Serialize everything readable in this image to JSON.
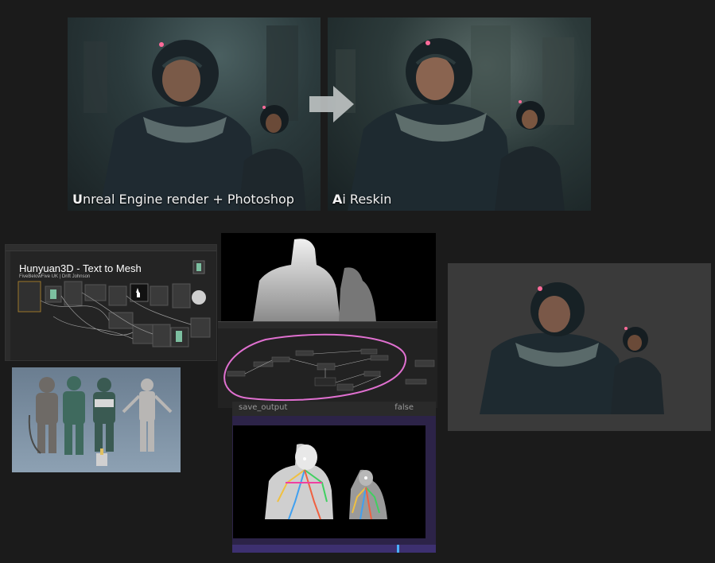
{
  "comparison": {
    "left_caption_first": "U",
    "left_caption_rest": "nreal Engine render + Photoshop",
    "right_caption_first": "A",
    "right_caption_rest": "i Reskin",
    "arrow_icon": "right-arrow-icon"
  },
  "hunyuan": {
    "title": "Hunyuan3D - Text to Mesh",
    "subtitle": "FiveBelowFive UK | Drift Johnson"
  },
  "save_output": {
    "label": "save_output",
    "value": "false"
  },
  "colors": {
    "background": "#1b1b1b",
    "workflow_highlight": "#e070d0",
    "panel_purple": "#2c2348"
  }
}
